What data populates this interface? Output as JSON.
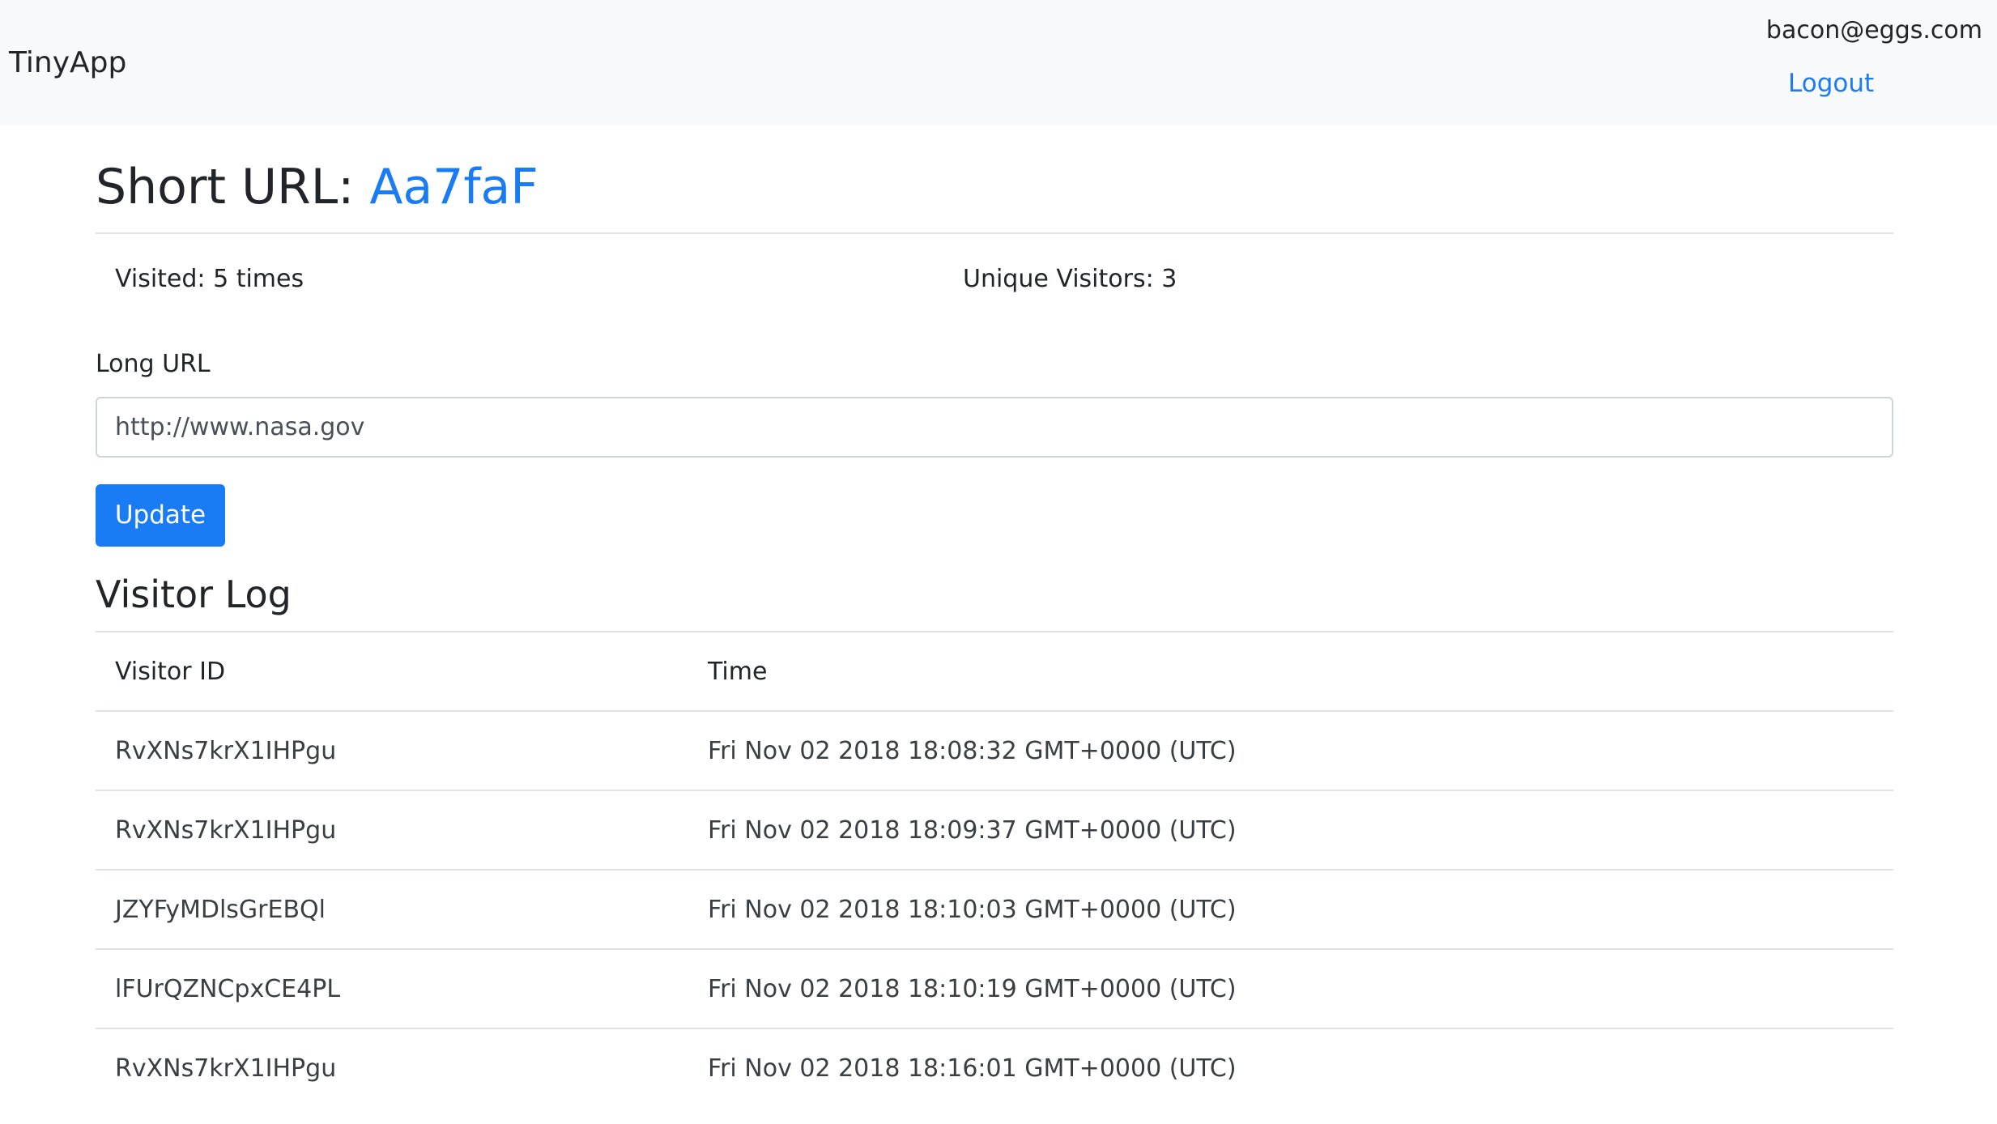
{
  "navbar": {
    "brand": "TinyApp",
    "user_email": "bacon@eggs.com",
    "logout_label": "Logout"
  },
  "page": {
    "title_prefix": "Short URL: ",
    "short_code": "Aa7faF"
  },
  "stats": {
    "visited": "Visited: 5 times",
    "unique": "Unique Visitors: 3"
  },
  "form": {
    "label": "Long URL",
    "long_url_value": "http://www.nasa.gov",
    "update_label": "Update"
  },
  "visitor_log": {
    "title": "Visitor Log",
    "columns": [
      "Visitor ID",
      "Time"
    ],
    "rows": [
      {
        "visitor_id": "RvXNs7krX1IHPgu",
        "time": "Fri Nov 02 2018 18:08:32 GMT+0000 (UTC)"
      },
      {
        "visitor_id": "RvXNs7krX1IHPgu",
        "time": "Fri Nov 02 2018 18:09:37 GMT+0000 (UTC)"
      },
      {
        "visitor_id": "JZYFyMDlsGrEBQl",
        "time": "Fri Nov 02 2018 18:10:03 GMT+0000 (UTC)"
      },
      {
        "visitor_id": "lFUrQZNCpxCE4PL",
        "time": "Fri Nov 02 2018 18:10:19 GMT+0000 (UTC)"
      },
      {
        "visitor_id": "RvXNs7krX1IHPgu",
        "time": "Fri Nov 02 2018 18:16:01 GMT+0000 (UTC)"
      }
    ]
  },
  "colors": {
    "accent": "#1a7cf5",
    "navbar_bg": "#f8f9fa",
    "divider": "#dee2e6"
  }
}
